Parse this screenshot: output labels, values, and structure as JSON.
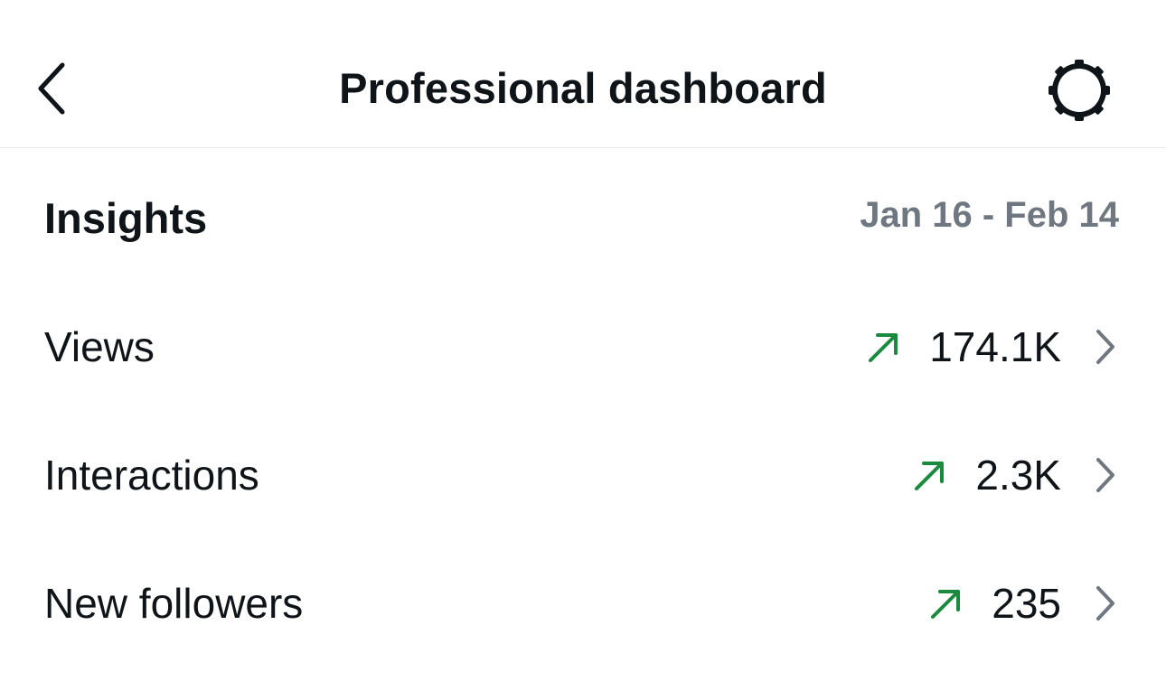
{
  "header": {
    "title": "Professional dashboard",
    "back_icon": "chevron-left-icon",
    "settings_icon": "gear-icon"
  },
  "insights": {
    "title": "Insights",
    "date_range": "Jan 16 - Feb 14"
  },
  "metrics": [
    {
      "label": "Views",
      "value": "174.1K",
      "trend": "up"
    },
    {
      "label": "Interactions",
      "value": "2.3K",
      "trend": "up"
    },
    {
      "label": "New followers",
      "value": "235",
      "trend": "up"
    }
  ],
  "colors": {
    "trend_up": "#1a8a3f",
    "muted": "#6f7780",
    "text": "#0f1419"
  }
}
